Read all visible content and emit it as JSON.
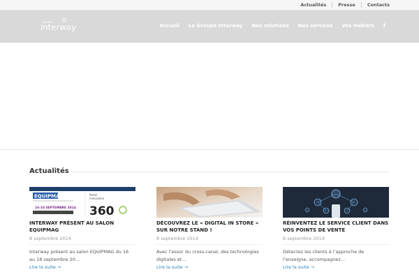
{
  "topbar": {
    "links": [
      "Actualités",
      "Presse",
      "Contacts"
    ]
  },
  "header": {
    "logo_small": "Groupe",
    "logo_word": "interway",
    "nav": [
      "Accueil",
      "Le Groupe Interway",
      "Nos solutions",
      "Nos services",
      "Vos métiers"
    ],
    "social_icon": "f"
  },
  "news": {
    "section_title": "Actualités",
    "posts": [
      {
        "title": "INTERWAY PRÉSENT AU SALON EQUIPMAG",
        "date": "8 septembre 2014",
        "excerpt": "Interway présent au salon EQUIPMAG du 16 au 18 septembre 20…",
        "more": "Lire la suite →",
        "thumb_label": "EQUIPMAG",
        "thumb_dates": "16-18 SEPTEMBRE 2014",
        "thumb_retail": "Retail",
        "thumb_innovation": "innovation",
        "thumb_360": "360"
      },
      {
        "title": "DÉCOUVREZ LE « DIGITAL IN STORE » SUR NOTRE STAND !",
        "date": "8 septembre 2014",
        "excerpt": "Avec l’essor du cross-canal, des technologies digitales et…",
        "more": "Lire la suite →"
      },
      {
        "title": "RÉINVENTEZ LE SERVICE CLIENT DANS VOS POINTS DE VENTE",
        "date": "8 septembre 2014",
        "excerpt": "Détectez les clients à l’approche de l’enseigne, accompagnez…",
        "more": "Lire la suite →"
      }
    ]
  },
  "colors": {
    "header_bg": "#d9d9d9",
    "link": "#2a7fb8",
    "thumb3_bg": "#1e2a3a"
  }
}
